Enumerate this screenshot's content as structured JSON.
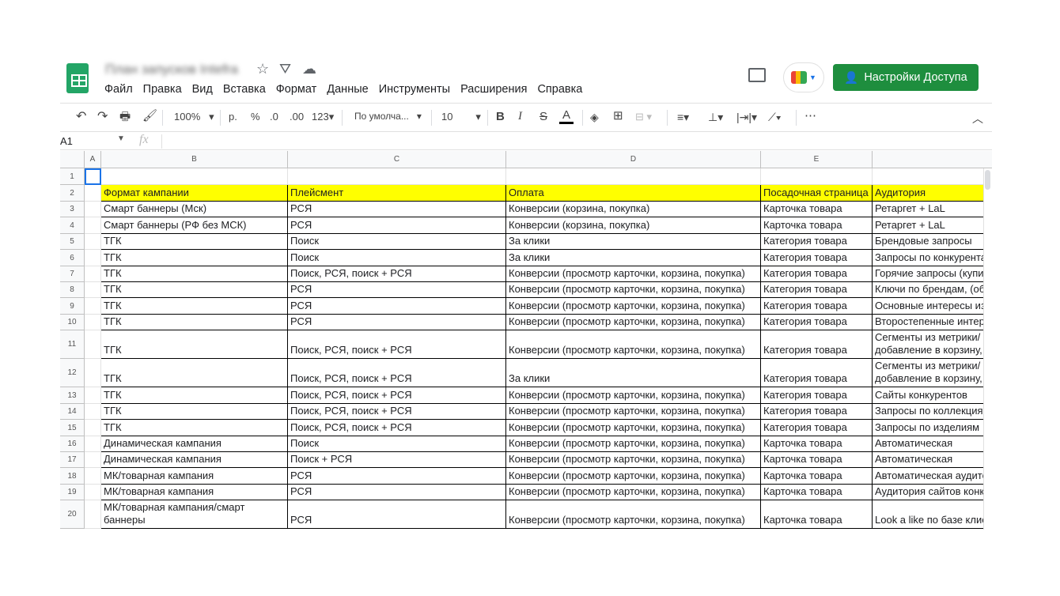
{
  "app": {
    "title": "План запусков Intefra",
    "share_label": "Настройки Доступа"
  },
  "menu": [
    "Файл",
    "Правка",
    "Вид",
    "Вставка",
    "Формат",
    "Данные",
    "Инструменты",
    "Расширения",
    "Справка"
  ],
  "toolbar": {
    "zoom": "100%",
    "currency": "р.",
    "percent": "%",
    "dec_less": ".0",
    "dec_more": ".00",
    "format": "123",
    "font": "По умолча...",
    "font_size": "10",
    "bold": "B",
    "italic": "I",
    "strike": "S",
    "text_color": "A",
    "more": "⋯"
  },
  "formula_bar": {
    "cell_ref": "A1",
    "fx": "fx",
    "value": ""
  },
  "columns": [
    "A",
    "B",
    "C",
    "D",
    "E",
    ""
  ],
  "rows": [
    {
      "n": "1",
      "cells": [
        "",
        "",
        "",
        "",
        "",
        ""
      ]
    },
    {
      "n": "2",
      "cells": [
        "",
        "Формат кампании",
        "Плейсмент",
        "Оплата",
        "Посадочная страница",
        "Аудитория"
      ]
    },
    {
      "n": "3",
      "cells": [
        "",
        "Смарт баннеры (Мск)",
        "РСЯ",
        "Конверсии (корзина, покупка)",
        "Карточка товара",
        "Ретаргет + LaL"
      ]
    },
    {
      "n": "4",
      "cells": [
        "",
        "Смарт баннеры (РФ без МСК)",
        "РСЯ",
        "Конверсии (корзина, покупка)",
        "Карточка товара",
        "Ретаргет + LaL"
      ]
    },
    {
      "n": "5",
      "cells": [
        "",
        "ТГК",
        "Поиск",
        "За клики",
        "Категория товара",
        "Брендовые запросы"
      ]
    },
    {
      "n": "6",
      "cells": [
        "",
        "ТГК",
        "Поиск",
        "За клики",
        "Категория товара",
        "Запросы по конкурентам"
      ]
    },
    {
      "n": "7",
      "cells": [
        "",
        "ТГК",
        "Поиск, РСЯ, поиск + РСЯ",
        "Конверсии (просмотр карточки, корзина, покупка)",
        "Категория товара",
        "Горячие запросы (купить"
      ]
    },
    {
      "n": "8",
      "cells": [
        "",
        "ТГК",
        "РСЯ",
        "Конверсии (просмотр карточки, корзина, покупка)",
        "Категория товара",
        "Ключи по брендам, (об"
      ]
    },
    {
      "n": "9",
      "cells": [
        "",
        "ТГК",
        "РСЯ",
        "Конверсии (просмотр карточки, корзина, покупка)",
        "Категория товара",
        "Основные интересы из"
      ]
    },
    {
      "n": "10",
      "cells": [
        "",
        "ТГК",
        "РСЯ",
        "Конверсии (просмотр карточки, корзина, покупка)",
        "Категория товара",
        "Второстепенные интерес"
      ]
    },
    {
      "n": "11",
      "cells": [
        "",
        "ТГК",
        "Поиск, РСЯ, поиск + РСЯ",
        "Конверсии (просмотр карточки, корзина, покупка)",
        "Категория товара",
        "Сегменты из метрики/\nдобавление в корзину,"
      ]
    },
    {
      "n": "12",
      "cells": [
        "",
        "ТГК",
        "Поиск, РСЯ, поиск + РСЯ",
        "За клики",
        "Категория товара",
        "Сегменты из метрики/\nдобавление в корзину,"
      ]
    },
    {
      "n": "13",
      "cells": [
        "",
        "ТГК",
        "Поиск, РСЯ, поиск + РСЯ",
        "Конверсии (просмотр карточки, корзина, покупка)",
        "Категория товара",
        "Сайты конкурентов"
      ]
    },
    {
      "n": "14",
      "cells": [
        "",
        "ТГК",
        "Поиск, РСЯ, поиск + РСЯ",
        "Конверсии (просмотр карточки, корзина, покупка)",
        "Категория товара",
        "Запросы по коллекциям"
      ]
    },
    {
      "n": "15",
      "cells": [
        "",
        "ТГК",
        "Поиск, РСЯ, поиск + РСЯ",
        "Конверсии (просмотр карточки, корзина, покупка)",
        "Категория товара",
        "Запросы по изделиям"
      ]
    },
    {
      "n": "16",
      "cells": [
        "",
        "Динамическая кампания",
        "Поиск",
        "Конверсии (просмотр карточки, корзина, покупка)",
        "Карточка товара",
        "Автоматическая"
      ]
    },
    {
      "n": "17",
      "cells": [
        "",
        "Динамическая кампания",
        "Поиск + РСЯ",
        "Конверсии (просмотр карточки, корзина, покупка)",
        "Карточка товара",
        "Автоматическая"
      ]
    },
    {
      "n": "18",
      "cells": [
        "",
        "МК/товарная кампания",
        "РСЯ",
        "Конверсии (просмотр карточки, корзина, покупка)",
        "Карточка товара",
        "Автоматическая аудитория"
      ]
    },
    {
      "n": "19",
      "cells": [
        "",
        "МК/товарная кампания",
        "РСЯ",
        "Конверсии (просмотр карточки, корзина, покупка)",
        "Карточка товара",
        "Аудитория сайтов конкурентов"
      ]
    },
    {
      "n": "20",
      "cells": [
        "",
        "МК/товарная кампания/смарт\nбаннеры",
        "РСЯ",
        "Конверсии (просмотр карточки, корзина, покупка)",
        "Карточка товара",
        "Look a like по базе клиентов"
      ]
    }
  ],
  "colors": {
    "header_fill": "#ffff00",
    "share_button": "#1e8e3e",
    "selection": "#1a73e8"
  }
}
